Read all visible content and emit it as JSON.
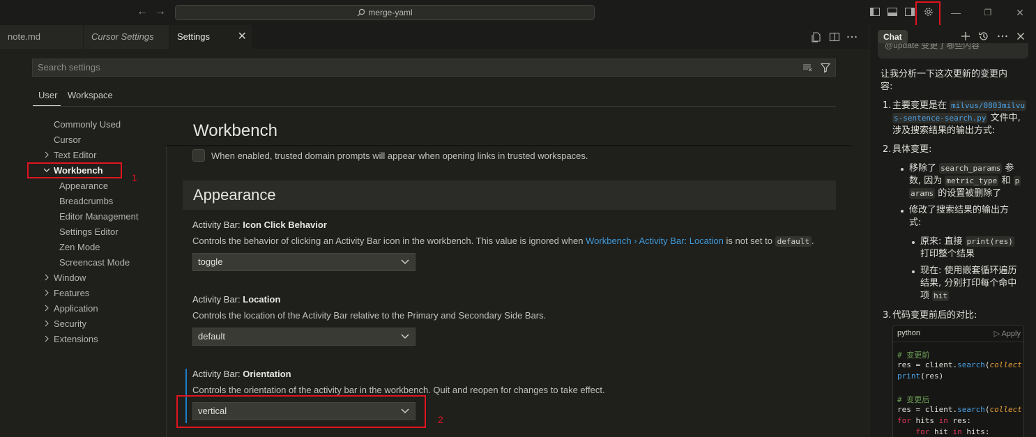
{
  "titlebar": {
    "back_label": "←",
    "forward_label": "→",
    "search_text": "merge-yaml",
    "min_label": "—",
    "max_label": "❐",
    "close_label": "✕"
  },
  "tabs": [
    {
      "label": "note.md"
    },
    {
      "label": "Cursor Settings"
    },
    {
      "label": "Settings"
    }
  ],
  "tab_close_label": "✕",
  "settings": {
    "search_placeholder": "Search settings",
    "scope_tabs": [
      "User",
      "Workspace"
    ],
    "toc": [
      "Commonly Used",
      "Cursor",
      "Text Editor",
      "Workbench",
      "Appearance",
      "Breadcrumbs",
      "Editor Management",
      "Settings Editor",
      "Zen Mode",
      "Screencast Mode",
      "Window",
      "Features",
      "Application",
      "Security",
      "Extensions"
    ],
    "section_title": "Workbench",
    "trusted_desc": "When enabled, trusted domain prompts will appear when opening links in trusted workspaces.",
    "appearance_header": "Appearance",
    "icon_click": {
      "category": "Activity Bar: ",
      "name": "Icon Click Behavior",
      "desc_before": "Controls the behavior of clicking an Activity Bar icon in the workbench. This value is ignored when ",
      "link": "Workbench › Activity Bar: Location",
      "desc_middle": " is not set to ",
      "code": "default",
      "desc_after": ".",
      "value": "toggle"
    },
    "location": {
      "category": "Activity Bar: ",
      "name": "Location",
      "desc": "Controls the location of the Activity Bar relative to the Primary and Secondary Side Bars.",
      "value": "default"
    },
    "orientation": {
      "category": "Activity Bar: ",
      "name": "Orientation",
      "desc": "Controls the orientation of the activity bar in the workbench. Quit and reopen for changes to take effect.",
      "value": "vertical"
    }
  },
  "annotations": [
    "1",
    "2"
  ],
  "chat": {
    "tab_label": "Chat",
    "prev_message": "@update 变更了哪些内容",
    "intro_1": "让我分析一下这次更新的变更内",
    "intro_2": "容:",
    "item1_num": "1.",
    "item1_a": "主要变更是在",
    "item1_code_1": "milvus/0803milvu",
    "item1_code_2": "s-sentence-search.py",
    "item1_b": "文件中,",
    "item1_c": "涉及搜索结果的输出方式:",
    "item2_num": "2.",
    "item2": "具体变更:",
    "b1_a": "移除了",
    "b1_code_1": "search_params",
    "b1_b": "参",
    "b1_c": "数, 因为",
    "b1_code_2": "metric_type",
    "b1_d": "和",
    "b1_code_3a": "p",
    "b1_code_3b": "arams",
    "b1_e": "的设置被删除了",
    "b2_a": "修改了搜索结果的输出方",
    "b2_b": "式:",
    "s1_a": "原来: 直接",
    "s1_code": "print(res)",
    "s1_b": "打印整个结果",
    "s2_a": "现在: 使用嵌套循环遍历",
    "s2_b": "结果, 分别打印每个命中",
    "s2_c": "项",
    "s2_code": "hit",
    "item3_num": "3.",
    "item3": "代码变更前后的对比:",
    "code_lang": "python",
    "code_apply": "▷ Apply",
    "code": {
      "c1": "# 变更前",
      "l2_a": "res",
      "l2_b": " = client.",
      "l2_c": "search",
      "l2_d": "(",
      "l2_e": "collect",
      "l3_a": "print",
      "l3_b": "(res)",
      "c2": "# 变更后",
      "l5_a": "res",
      "l5_b": " = client.",
      "l5_c": "search",
      "l5_d": "(",
      "l5_e": "collect",
      "l6_a": "for",
      "l6_b": " hits ",
      "l6_c": "in",
      "l6_d": " res:",
      "l7_a": "    for",
      "l7_b": " hit ",
      "l7_c": "in",
      "l7_d": " hits:"
    }
  },
  "colors": {
    "accent_blue": "#1c80c8",
    "annotation_red": "#e0141e",
    "link_blue": "#3f9ad8"
  }
}
